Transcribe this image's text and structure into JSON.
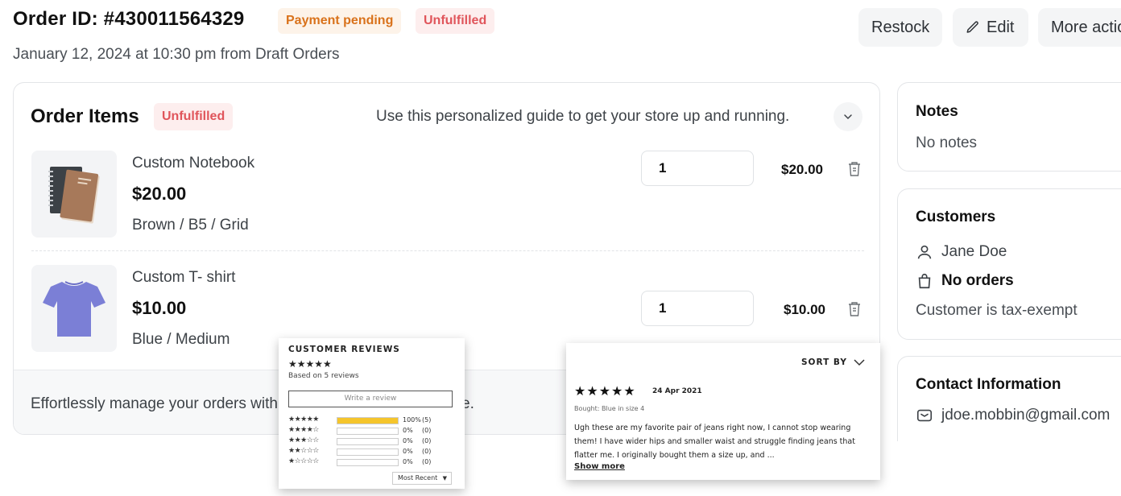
{
  "header": {
    "order_id": "Order ID: #430011564329",
    "badge_payment": "Payment pending",
    "badge_fulfillment": "Unfulfilled",
    "subtitle": "January 12, 2024 at 10:30 pm from Draft Orders",
    "buttons": {
      "restock": "Restock",
      "edit": "Edit",
      "more": "More actions"
    }
  },
  "order_items": {
    "title": "Order Items",
    "badge": "Unfulfilled",
    "guide": "Use this personalized guide to get your store up and running.",
    "items": [
      {
        "name": "Custom Notebook",
        "price": "$20.00",
        "variant": "Brown / B5 / Grid",
        "quantity": "1",
        "total": "$20.00",
        "icon": "notebook-image"
      },
      {
        "name": "Custom T- shirt",
        "price": "$10.00",
        "variant": "Blue / Medium",
        "quantity": "1",
        "total": "$10.00",
        "icon": "tshirt-image"
      }
    ],
    "footer": "Effortlessly manage your orders with our intuitive Order List page."
  },
  "notes": {
    "title": "Notes",
    "text": "No notes"
  },
  "customers": {
    "title": "Customers",
    "name": "Jane Doe",
    "orders": "No orders",
    "tax": "Customer is tax-exempt"
  },
  "contact": {
    "title": "Contact Information",
    "email": "jdoe.mobbin@gmail.com"
  },
  "reviews_widget": {
    "title": "CUSTOMER REVIEWS",
    "stars": "★★★★★",
    "based_on": "Based on 5 reviews",
    "write": "Write a review",
    "distribution": [
      {
        "stars": "★★★★★",
        "fraction": 1.0,
        "pct": "100%",
        "count": "(5)"
      },
      {
        "stars": "★★★★☆",
        "fraction": 0.0,
        "pct": "0%",
        "count": "(0)"
      },
      {
        "stars": "★★★☆☆",
        "fraction": 0.0,
        "pct": "0%",
        "count": "(0)"
      },
      {
        "stars": "★★☆☆☆",
        "fraction": 0.0,
        "pct": "0%",
        "count": "(0)"
      },
      {
        "stars": "★☆☆☆☆",
        "fraction": 0.0,
        "pct": "0%",
        "count": "(0)"
      }
    ],
    "sort": "Most Recent",
    "accent": "#f5c52c"
  },
  "review_detail": {
    "sort_by": "SORT BY",
    "stars": "★★★★★",
    "date": "24 Apr 2021",
    "bought": "Bought: Blue in size 4",
    "body": "Ugh these are my favorite pair of jeans right now, I cannot stop wearing them! I have wider hips and smaller waist and struggle finding jeans that flatter me. I originally bought them a size up, and ...",
    "show_more": "Show more"
  }
}
